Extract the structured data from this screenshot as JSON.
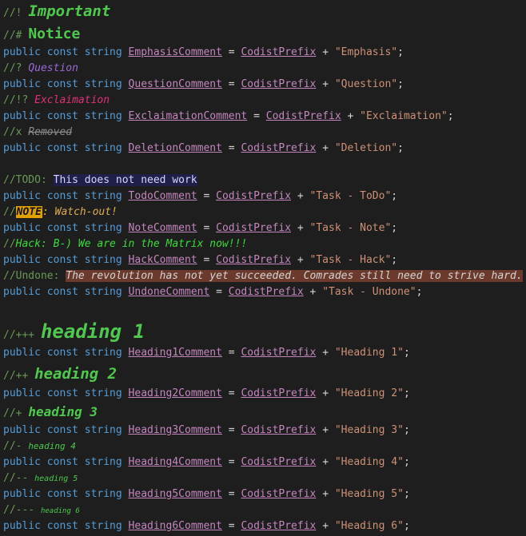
{
  "lines": {
    "important": {
      "prefix": "//!",
      "text": "Important"
    },
    "notice": {
      "prefix": "//#",
      "text": "Notice"
    },
    "emphasis_decl": {
      "kw": "public const string",
      "name": "EmphasisComment",
      "eq": "=",
      "ref": "CodistPrefix",
      "plus": "+",
      "str": "\"Emphasis\"",
      "end": ";"
    },
    "question": {
      "prefix": "//?",
      "text": "Question"
    },
    "question_decl": {
      "kw": "public const string",
      "name": "QuestionComment",
      "eq": "=",
      "ref": "CodistPrefix",
      "plus": "+",
      "str": "\"Question\"",
      "end": ";"
    },
    "exclamation": {
      "prefix": "//!?",
      "text": "Exclaimation"
    },
    "exclamation_decl": {
      "kw": "public const string",
      "name": "ExclaimationComment",
      "eq": "=",
      "ref": "CodistPrefix",
      "plus": "+",
      "str": "\"Exclaimation\"",
      "end": ";"
    },
    "removed": {
      "prefix": "//x",
      "text": "Removed"
    },
    "deletion_decl": {
      "kw": "public const string",
      "name": "DeletionComment",
      "eq": "=",
      "ref": "CodistPrefix",
      "plus": "+",
      "str": "\"Deletion\"",
      "end": ";"
    },
    "todo": {
      "prefix": "//TODO:",
      "text": "This does not need work"
    },
    "todo_decl": {
      "kw": "public const string",
      "name": "TodoComment",
      "eq": "=",
      "ref": "CodistPrefix",
      "plus": "+",
      "str": "\"Task - ToDo\"",
      "end": ";"
    },
    "note": {
      "prefix": "//",
      "tag": "NOTE",
      "text": ": Watch-out!"
    },
    "note_decl": {
      "kw": "public const string",
      "name": "NoteComment",
      "eq": "=",
      "ref": "CodistPrefix",
      "plus": "+",
      "str": "\"Task - Note\"",
      "end": ";"
    },
    "hack": {
      "prefix": "//",
      "tag": "Hack",
      "text": ": B-) We are in the Matrix now!!!"
    },
    "hack_decl": {
      "kw": "public const string",
      "name": "HackComment",
      "eq": "=",
      "ref": "CodistPrefix",
      "plus": "+",
      "str": "\"Task - Hack\"",
      "end": ";"
    },
    "undone": {
      "prefix": "//Undone:",
      "text": "The revolution has not yet succeeded. Comrades still need to strive hard."
    },
    "undone_decl": {
      "kw": "public const string",
      "name": "UndoneComment",
      "eq": "=",
      "ref": "CodistPrefix",
      "plus": "+",
      "str": "\"Task - Undone\"",
      "end": ";"
    },
    "h1": {
      "prefix": "//+++",
      "text": "heading 1"
    },
    "h1_decl": {
      "kw": "public const string",
      "name": "Heading1Comment",
      "eq": "=",
      "ref": "CodistPrefix",
      "plus": "+",
      "str": "\"Heading 1\"",
      "end": ";"
    },
    "h2": {
      "prefix": "//++",
      "text": "heading 2"
    },
    "h2_decl": {
      "kw": "public const string",
      "name": "Heading2Comment",
      "eq": "=",
      "ref": "CodistPrefix",
      "plus": "+",
      "str": "\"Heading 2\"",
      "end": ";"
    },
    "h3": {
      "prefix": "//+",
      "text": "heading 3"
    },
    "h3_decl": {
      "kw": "public const string",
      "name": "Heading3Comment",
      "eq": "=",
      "ref": "CodistPrefix",
      "plus": "+",
      "str": "\"Heading 3\"",
      "end": ";"
    },
    "h4": {
      "prefix": "//-",
      "text": "heading 4"
    },
    "h4_decl": {
      "kw": "public const string",
      "name": "Heading4Comment",
      "eq": "=",
      "ref": "CodistPrefix",
      "plus": "+",
      "str": "\"Heading 4\"",
      "end": ";"
    },
    "h5": {
      "prefix": "//--",
      "text": "heading 5"
    },
    "h5_decl": {
      "kw": "public const string",
      "name": "Heading5Comment",
      "eq": "=",
      "ref": "CodistPrefix",
      "plus": "+",
      "str": "\"Heading 5\"",
      "end": ";"
    },
    "h6": {
      "prefix": "//---",
      "text": "heading 6"
    },
    "h6_decl": {
      "kw": "public const string",
      "name": "Heading6Comment",
      "eq": "=",
      "ref": "CodistPrefix",
      "plus": "+",
      "str": "\"Heading 6\"",
      "end": ";"
    }
  },
  "colors": {
    "background": "#1e1e1e",
    "keyword": "#569cd6",
    "identifier": "#c586c0",
    "string": "#ce9178",
    "comment": "#6a9955",
    "heading": "#4ec94e"
  }
}
